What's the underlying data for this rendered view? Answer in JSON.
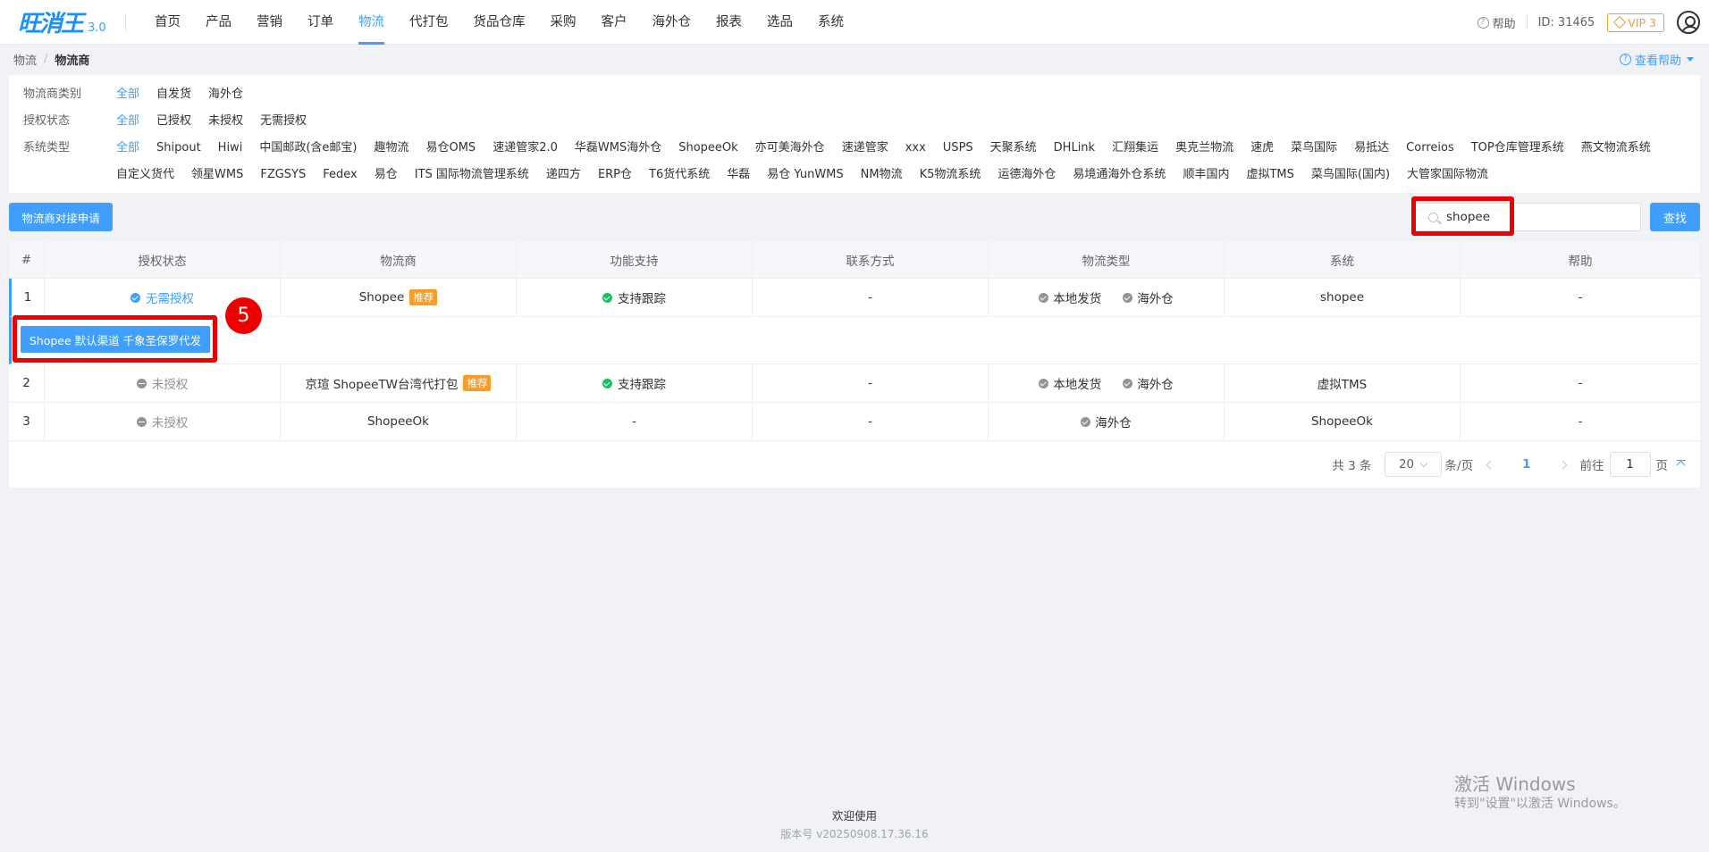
{
  "app": {
    "logo": "旺消王",
    "version": "3.0"
  },
  "nav": [
    "首页",
    "产品",
    "营销",
    "订单",
    "物流",
    "代打包",
    "货品仓库",
    "采购",
    "客户",
    "海外仓",
    "报表",
    "选品",
    "系统"
  ],
  "nav_active": "物流",
  "top_right": {
    "help": "帮助",
    "id": "ID: 31465",
    "vip": "VIP 3"
  },
  "breadcrumb": {
    "parent": "物流",
    "current": "物流商",
    "view_help": "查看帮助"
  },
  "filters": {
    "category": {
      "label": "物流商类别",
      "options": [
        "全部",
        "自发货",
        "海外仓"
      ]
    },
    "auth": {
      "label": "授权状态",
      "options": [
        "全部",
        "已授权",
        "未授权",
        "无需授权"
      ]
    },
    "system": {
      "label": "系统类型",
      "options": [
        "全部",
        "Shipout",
        "Hiwi",
        "中国邮政(含e邮宝)",
        "趣物流",
        "易仓OMS",
        "速递管家2.0",
        "华磊WMS海外仓",
        "ShopeeOk",
        "亦可美海外仓",
        "速递管家",
        "xxx",
        "USPS",
        "天聚系统",
        "DHLink",
        "汇翔集运",
        "奥克兰物流",
        "速虎",
        "菜鸟国际",
        "易抵达",
        "Correios",
        "TOP仓库管理系统",
        "燕文物流系统",
        "自定义货代",
        "领星WMS",
        "FZGSYS",
        "Fedex",
        "易仓",
        "ITS 国际物流管理系统",
        "递四方",
        "ERP仓",
        "T6货代系统",
        "华磊",
        "易仓 YunWMS",
        "NM物流",
        "K5物流系统",
        "运德海外仓",
        "易境通海外仓系统",
        "顺丰国内",
        "虚拟TMS",
        "菜鸟国际(国内)",
        "大管家国际物流"
      ]
    }
  },
  "toolbar": {
    "apply_button": "物流商对接申请",
    "search_value": "shopee",
    "search_button": "查找"
  },
  "table": {
    "headers": [
      "#",
      "授权状态",
      "物流商",
      "功能支持",
      "联系方式",
      "物流类型",
      "系统",
      "帮助"
    ],
    "rows": [
      {
        "index": "1",
        "auth": "无需授权",
        "provider": "Shopee",
        "tag": "推荐",
        "feature": "支持跟踪",
        "contact": "-",
        "types": [
          "本地发货",
          "海外仓"
        ],
        "system": "shopee",
        "help": "-"
      },
      {
        "index": "2",
        "auth": "未授权",
        "provider": "京瑄 ShopeeTW台湾代打包",
        "tag": "推荐",
        "feature": "支持跟踪",
        "contact": "-",
        "types": [
          "本地发货",
          "海外仓"
        ],
        "system": "虚拟TMS",
        "help": "-"
      },
      {
        "index": "3",
        "auth": "未授权",
        "provider": "ShopeeOk",
        "tag": "",
        "feature": "-",
        "contact": "-",
        "types": [
          "海外仓"
        ],
        "system": "ShopeeOk",
        "help": "-"
      }
    ],
    "expand_channel": "Shopee 默认渠道 千象圣保罗代发"
  },
  "pagination": {
    "total": "共 3 条",
    "page_size": "20",
    "per_page": "条/页",
    "current": "1",
    "goto": "前往",
    "goto_value": "1",
    "page_unit": "页"
  },
  "annotation": {
    "step": "5"
  },
  "footer": {
    "welcome": "欢迎使用",
    "version": "版本号 v20250908.17.36.16"
  },
  "watermark": {
    "line1": "激活 Windows",
    "line2": "转到\"设置\"以激活 Windows。"
  },
  "colors": {
    "primary": "#409eff",
    "highlight": "#ee0000",
    "tag": "#fa9d27",
    "success": "#19be6b"
  }
}
